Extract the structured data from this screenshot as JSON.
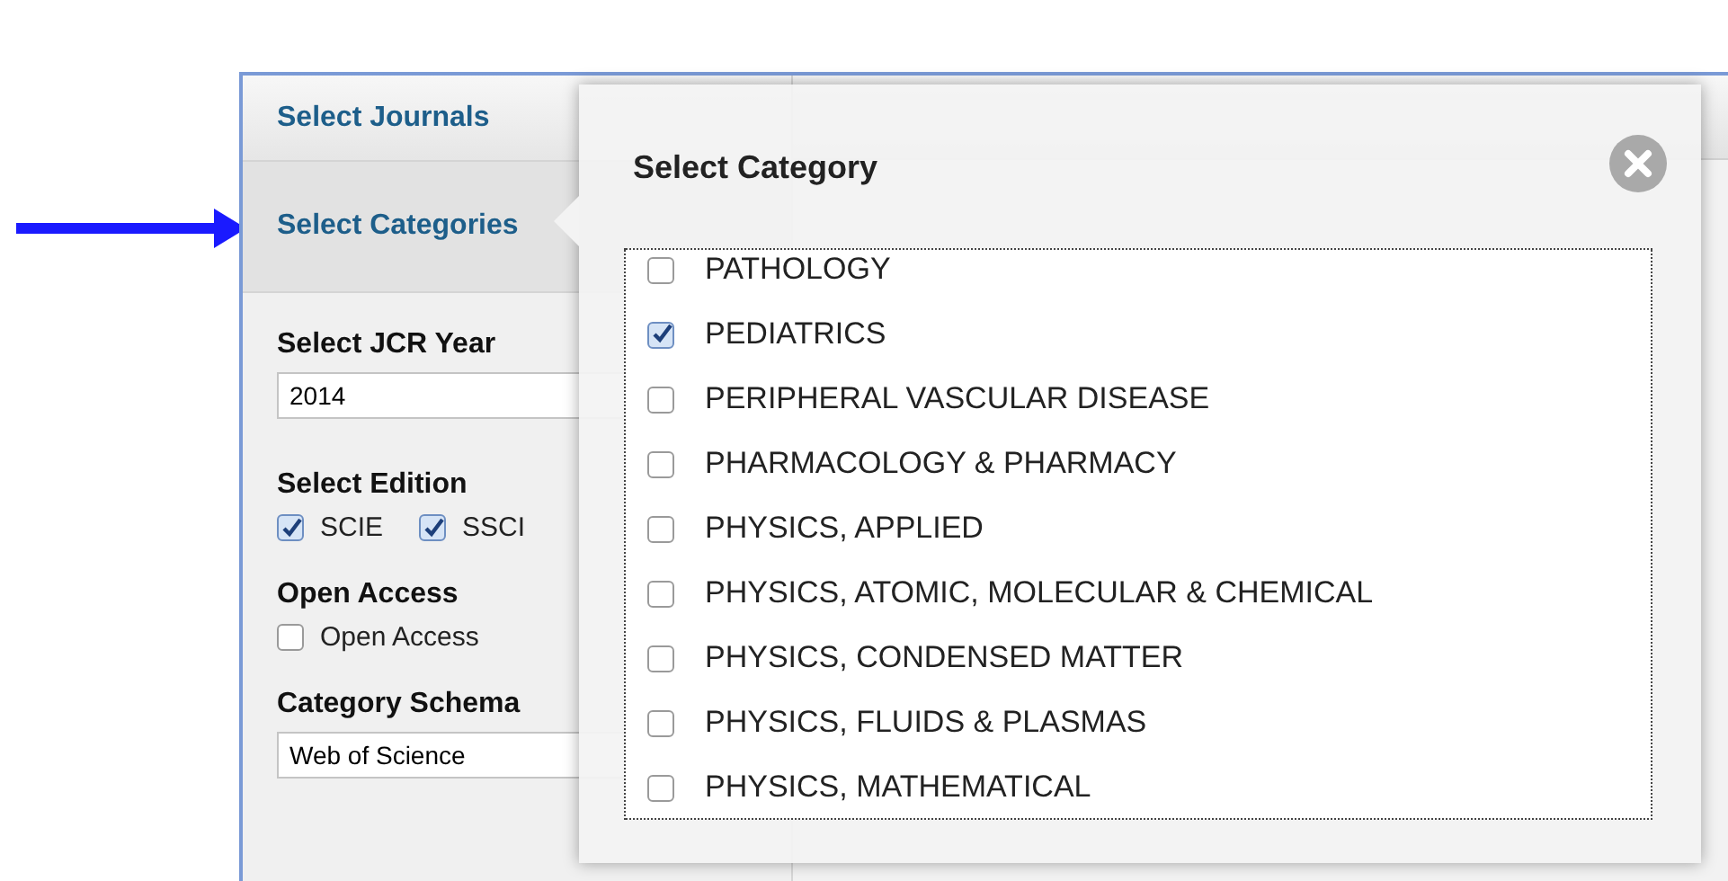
{
  "sidebar": {
    "tabs": [
      {
        "label": "Select Journals",
        "selected": false
      },
      {
        "label": "Select Categories",
        "selected": true
      }
    ],
    "year": {
      "label": "Select JCR Year",
      "value": "2014"
    },
    "edition": {
      "label": "Select Edition",
      "options": [
        {
          "label": "SCIE",
          "checked": true
        },
        {
          "label": "SSCI",
          "checked": true
        }
      ]
    },
    "open_access": {
      "label": "Open Access",
      "options": [
        {
          "label": "Open Access",
          "checked": false
        }
      ]
    },
    "schema": {
      "label": "Category Schema",
      "value": "Web of Science"
    }
  },
  "modal": {
    "title": "Select Category",
    "items": [
      {
        "label": "PATHOLOGY",
        "checked": false
      },
      {
        "label": "PEDIATRICS",
        "checked": true
      },
      {
        "label": "PERIPHERAL VASCULAR DISEASE",
        "checked": false
      },
      {
        "label": "PHARMACOLOGY & PHARMACY",
        "checked": false
      },
      {
        "label": "PHYSICS, APPLIED",
        "checked": false
      },
      {
        "label": "PHYSICS, ATOMIC, MOLECULAR & CHEMICAL",
        "checked": false
      },
      {
        "label": "PHYSICS, CONDENSED MATTER",
        "checked": false
      },
      {
        "label": "PHYSICS, FLUIDS & PLASMAS",
        "checked": false
      },
      {
        "label": "PHYSICS, MATHEMATICAL",
        "checked": false
      }
    ]
  }
}
